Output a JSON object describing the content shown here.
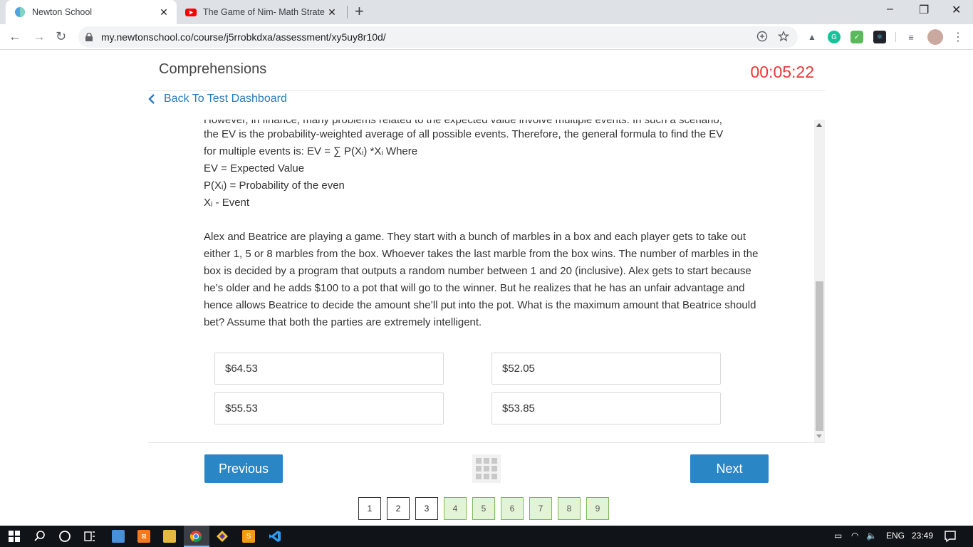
{
  "browser": {
    "tabs": [
      {
        "title": "Newton School",
        "close": "✕"
      },
      {
        "title": "The Game of Nim- Math Strategy",
        "close": "✕"
      }
    ],
    "new_tab": "+",
    "window_controls": {
      "minimize": "–",
      "restore": "❐",
      "close": "✕"
    },
    "nav": {
      "back": "←",
      "forward": "→",
      "reload": "↻"
    },
    "url": "my.newtonschool.co/course/j5rrobkdxa/assessment/xy5uy8r10d/",
    "omnibox_icons": [
      "add-circle-icon",
      "star-icon"
    ]
  },
  "page": {
    "title": "Comprehensions",
    "timer": "00:05:22",
    "back_link": "Back To Test Dashboard",
    "cut_off_line": "However, in finance, many problems related to the expected value involve multiple events. In such a scenario,",
    "question_lines": [
      "the EV is the probability-weighted average of all possible events. Therefore, the general formula to find the EV",
      "for multiple events is: EV = ∑ P(Xᵢ) *Xᵢ Where",
      "EV = Expected Value",
      "P(Xᵢ) = Probability of the even",
      "Xᵢ - Event"
    ],
    "question_paragraph": "Alex and Beatrice are playing a game. They start with a bunch of marbles in a box and each player gets to take out either 1, 5 or 8 marbles from the box. Whoever takes the last marble from the box wins. The number of marbles in the box is decided by a program that outputs a random number between 1 and 20 (inclusive). Alex gets to start because he’s older and he adds $100 to a pot that will go to the winner. But he realizes that he has an unfair advantage and hence allows Beatrice to decide the amount she’ll put into the pot. What is the maximum amount that Beatrice should bet? Assume that both the parties are extremely intelligent.",
    "options": [
      "$64.53",
      "$52.05",
      "$55.53",
      "$53.85"
    ],
    "previous_label": "Previous",
    "next_label": "Next",
    "pages": [
      {
        "label": "1",
        "answered": false
      },
      {
        "label": "2",
        "answered": false
      },
      {
        "label": "3",
        "answered": false
      },
      {
        "label": "4",
        "answered": true
      },
      {
        "label": "5",
        "answered": true
      },
      {
        "label": "6",
        "answered": true
      },
      {
        "label": "7",
        "answered": true
      },
      {
        "label": "8",
        "answered": true
      },
      {
        "label": "9",
        "answered": true
      }
    ]
  },
  "taskbar": {
    "language": "ENG",
    "clock": "23:49"
  },
  "colors": {
    "timer": "#e53935",
    "link": "#2a7bbd",
    "button": "#2b86c5",
    "answered_page": "#e3f4d6"
  }
}
